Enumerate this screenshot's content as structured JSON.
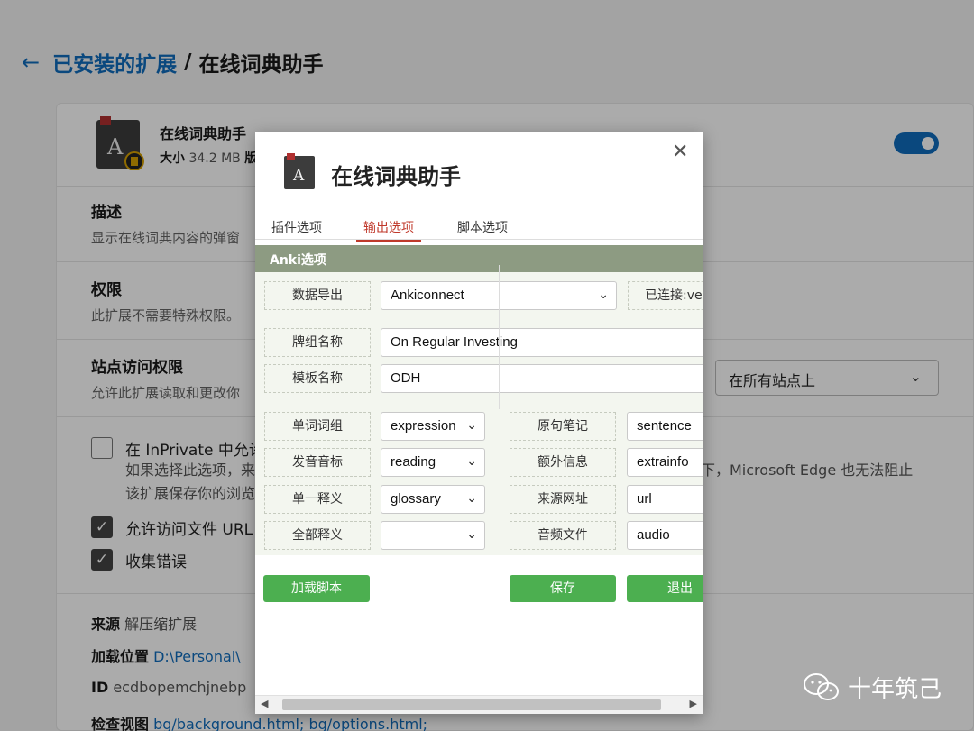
{
  "breadcrumb": {
    "link": "已安装的扩展",
    "separator": "/",
    "current": "在线词典助手"
  },
  "extension": {
    "name": "在线词典助手",
    "size_label": "大小",
    "size_value": "34.2 MB",
    "size_extra": "版"
  },
  "sections": {
    "description": {
      "title": "描述",
      "text": "显示在线词典内容的弹窗"
    },
    "permissions": {
      "title": "权限",
      "text": "此扩展不需要特殊权限。"
    },
    "site_access": {
      "title": "站点访问权限",
      "text": "允许此扩展读取和更改你",
      "select_value": "在所有站点上"
    }
  },
  "options": {
    "inprivate": {
      "label": "在 InPrivate 中允许",
      "desc1": "如果选择此选项，来",
      "desc1_right": "下，Microsoft Edge 也无法阻止",
      "desc2": "该扩展保存你的浏览"
    },
    "file_urls": {
      "label": "允许访问文件 URL"
    },
    "collect_errors": {
      "label": "收集错误"
    }
  },
  "details": {
    "source_label": "来源",
    "source_value": "解压缩扩展",
    "location_label": "加载位置",
    "location_value": "D:\\Personal\\",
    "id_label": "ID",
    "id_value": "ecdbopemchjnebp",
    "views_label": "检查视图",
    "views_value1": "bg/background.html;",
    "views_value2": "bg/options.html;"
  },
  "popup": {
    "title": "在线词典助手",
    "close": "✕",
    "tabs": [
      "插件选项",
      "输出选项",
      "脚本选项"
    ],
    "section_title": "Anki选项",
    "export": {
      "label": "数据导出",
      "value": "Ankiconnect",
      "status": "已连接:ve"
    },
    "deck": {
      "label": "牌组名称",
      "value": "On Regular Investing"
    },
    "model": {
      "label": "模板名称",
      "value": "ODH"
    },
    "fields_left": [
      {
        "label": "单词词组",
        "value": "expression"
      },
      {
        "label": "发音音标",
        "value": "reading"
      },
      {
        "label": "单一释义",
        "value": "glossary"
      },
      {
        "label": "全部释义",
        "value": ""
      }
    ],
    "fields_right": [
      {
        "label": "原句笔记",
        "value": "sentence"
      },
      {
        "label": "额外信息",
        "value": "extrainfo"
      },
      {
        "label": "来源网址",
        "value": "url"
      },
      {
        "label": "音频文件",
        "value": "audio"
      }
    ],
    "buttons": {
      "load_script": "加载脚本",
      "save": "保存",
      "exit": "退出"
    }
  },
  "watermark": {
    "text": "十年筑己"
  },
  "colors": {
    "accent_blue": "#0f6cbd",
    "green_button": "#4caf50",
    "anki_band": "#8d9b82",
    "active_tab": "#c0392b"
  }
}
